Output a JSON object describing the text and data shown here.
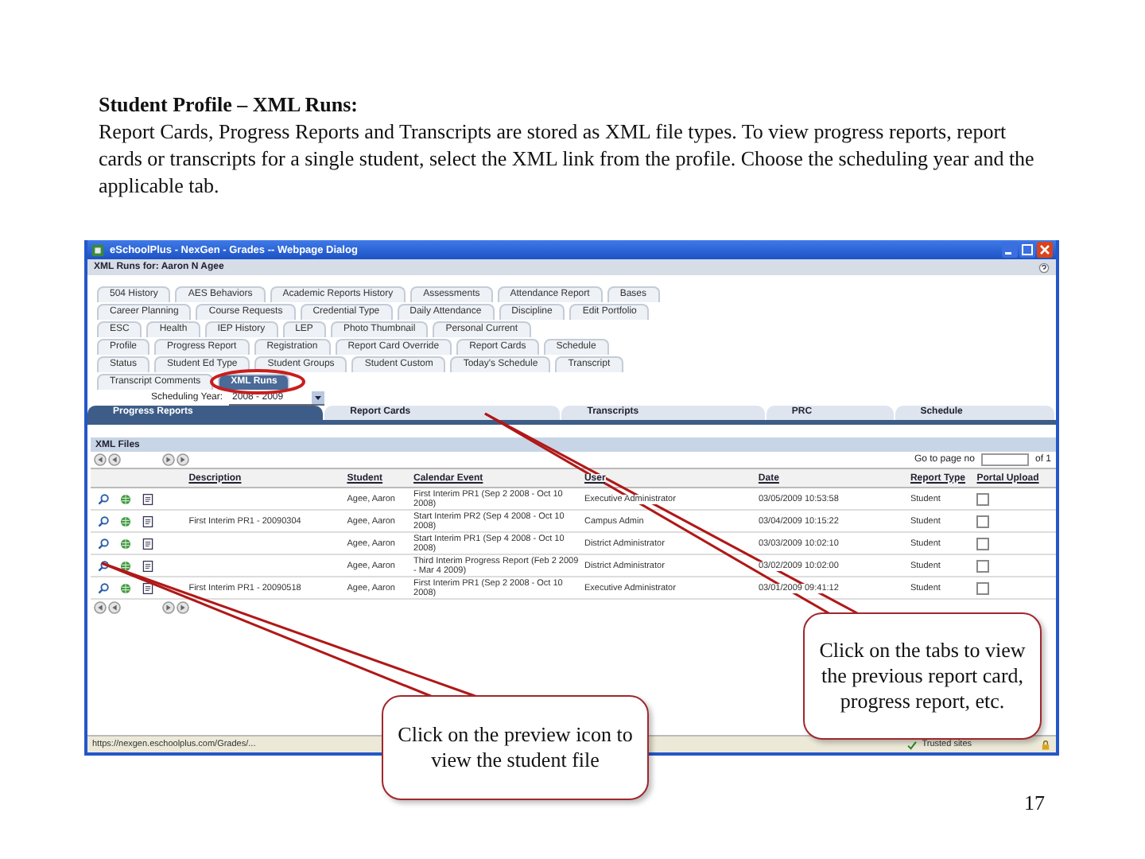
{
  "document": {
    "heading": "Student Profile – XML Runs:",
    "paragraph": "Report Cards, Progress Reports and Transcripts are stored as XML file types. To view progress reports, report cards or transcripts for a single student, select the XML link from the profile. Choose the scheduling year and the applicable tab.",
    "page_number": "17"
  },
  "window": {
    "title": "eSchoolPlus - NexGen - Grades -- Webpage Dialog",
    "subtitle": "XML Runs for: Aaron N Agee",
    "tab_rows": [
      [
        {
          "label": "504 History",
          "selected": false
        },
        {
          "label": "AES Behaviors",
          "selected": false
        },
        {
          "label": "Academic Reports History",
          "selected": false
        },
        {
          "label": "Assessments",
          "selected": false
        },
        {
          "label": "Attendance Report",
          "selected": false
        },
        {
          "label": "Bases",
          "selected": false
        }
      ],
      [
        {
          "label": "Career Planning",
          "selected": false
        },
        {
          "label": "Course Requests",
          "selected": false
        },
        {
          "label": "Credential Type",
          "selected": false
        },
        {
          "label": "Daily Attendance",
          "selected": false
        },
        {
          "label": "Discipline",
          "selected": false
        },
        {
          "label": "Edit Portfolio",
          "selected": false
        }
      ],
      [
        {
          "label": "ESC",
          "selected": false
        },
        {
          "label": "Health",
          "selected": false
        },
        {
          "label": "IEP History",
          "selected": false
        },
        {
          "label": "LEP",
          "selected": false
        },
        {
          "label": "Photo Thumbnail",
          "selected": false
        },
        {
          "label": "Personal Current",
          "selected": false
        }
      ],
      [
        {
          "label": "Profile",
          "selected": false
        },
        {
          "label": "Progress Report",
          "selected": false
        },
        {
          "label": "Registration",
          "selected": false
        },
        {
          "label": "Report Card Override",
          "selected": false
        },
        {
          "label": "Report Cards",
          "selected": false
        },
        {
          "label": "Schedule",
          "selected": false
        }
      ],
      [
        {
          "label": "Status",
          "selected": false
        },
        {
          "label": "Student Ed Type",
          "selected": false
        },
        {
          "label": "Student Groups",
          "selected": false
        },
        {
          "label": "Student Custom",
          "selected": false
        },
        {
          "label": "Today's Schedule",
          "selected": false
        },
        {
          "label": "Transcript",
          "selected": false
        }
      ],
      [
        {
          "label": "Transcript Comments",
          "selected": false
        },
        {
          "label": "XML Runs",
          "selected": true
        }
      ]
    ],
    "scheduling_year": {
      "label": "Scheduling Year:",
      "value": "2008 - 2009"
    },
    "report_tabs": [
      {
        "label": "Progress Reports",
        "selected": true
      },
      {
        "label": "Report Cards",
        "selected": false
      },
      {
        "label": "Transcripts",
        "selected": false
      },
      {
        "label": "PRC",
        "selected": false
      },
      {
        "label": "Schedule",
        "selected": false
      }
    ],
    "section_title": "XML Files",
    "pager": {
      "label": "Go to page no",
      "of": "of 1"
    },
    "table": {
      "columns": [
        "Description",
        "Student",
        "Calendar Event",
        "User",
        "Date",
        "Report Type",
        "Portal Upload"
      ],
      "rows": [
        {
          "student": "Agee, Aaron",
          "calendar_event": "First Interim PR1 (Sep 2 2008 - Oct 10 2008)",
          "user": "Executive Administrator",
          "date": "03/05/2009 10:53:58",
          "report_type": "Student",
          "portal_upload": false
        },
        {
          "description": "First Interim PR1 - 20090304",
          "student": "Agee, Aaron",
          "calendar_event": "Start Interim PR2 (Sep 4 2008 - Oct 10 2008)",
          "user": "Campus Admin",
          "date": "03/04/2009 10:15:22",
          "report_type": "Student",
          "portal_upload": false
        },
        {
          "student": "Agee, Aaron",
          "calendar_event": "Start Interim PR1 (Sep 4 2008 - Oct 10 2008)",
          "user": "District Administrator",
          "date": "03/03/2009 10:02:10",
          "report_type": "Student",
          "portal_upload": false
        },
        {
          "student": "Agee, Aaron",
          "calendar_event": "Third Interim Progress Report (Feb 2 2009 - Mar 4 2009)",
          "user": "District Administrator",
          "date": "03/02/2009 10:02:00",
          "report_type": "Student",
          "portal_upload": false
        },
        {
          "description": "First Interim PR1 - 20090518",
          "student": "Agee, Aaron",
          "calendar_event": "First Interim PR1 (Sep 2 2008 - Oct 10 2008)",
          "user": "Executive Administrator",
          "date": "03/01/2009 09:41:12",
          "report_type": "Student",
          "portal_upload": false
        }
      ]
    },
    "status_bar": {
      "url": "https://nexgen.eschoolplus.com/Grades/...",
      "zone": "Trusted sites"
    }
  },
  "callouts": [
    {
      "text": "Click on the tabs to view the previous report card, progress report, etc."
    },
    {
      "text": "Click on the preview icon to view the student file"
    }
  ]
}
